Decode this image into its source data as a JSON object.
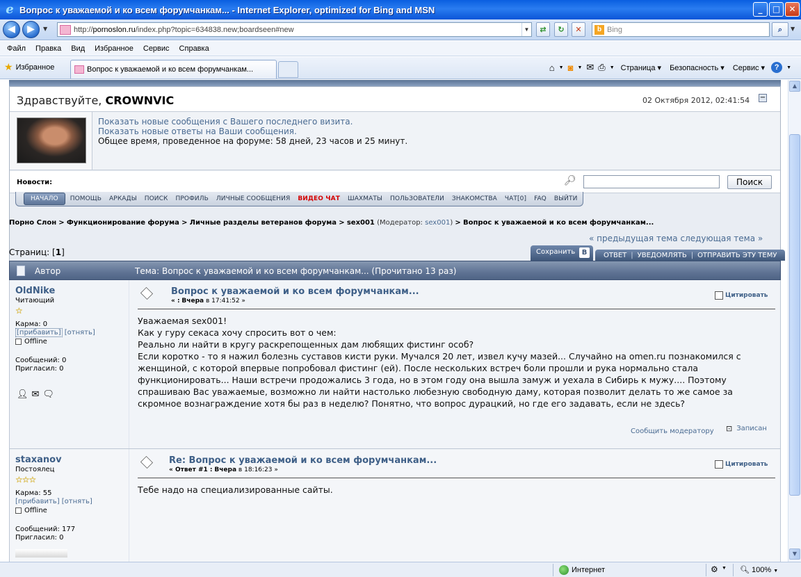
{
  "window": {
    "title": "Вопрос к уважаемой и ко всем форумчанкам... - Internet Explorer, optimized for Bing and MSN",
    "min": "_",
    "max": "□",
    "close": "✕"
  },
  "address": {
    "url_prefix": "http://",
    "url_host": "pornoslon.ru",
    "url_path": "/index.php?topic=634838.new;boardseen#new",
    "search_placeholder": "Bing"
  },
  "menu": [
    "Файл",
    "Правка",
    "Вид",
    "Избранное",
    "Сервис",
    "Справка"
  ],
  "favorites": {
    "label": "Избранное",
    "tab_title": "Вопрос к уважаемой и ко всем форумчанкам..."
  },
  "commandbar": {
    "page": "Страница",
    "safety": "Безопасность",
    "tools": "Сервис",
    "help": "?"
  },
  "status": {
    "zone": "Интернет",
    "zoom": "100%"
  },
  "welcome": {
    "greeting": "Здравствуйте, ",
    "username": "CROWNVIC",
    "datetime": "02 Октября 2012, 02:41:54",
    "link_new_posts": "Показать новые сообщения с Вашего последнего визита.",
    "link_new_replies": "Показать новые ответы на Ваши сообщения.",
    "total_time": "Общее время, проведенное на форуме: 58 дней, 23 часов и 25 минут.",
    "news_label": "Новости:",
    "search_button": "Поиск"
  },
  "nav": [
    "НАЧАЛО",
    "ПОМОЩЬ",
    "АРКАДЫ",
    "ПОИСК",
    "ПРОФИЛЬ",
    "ЛИЧНЫЕ СООБЩЕНИЯ",
    "ВИДЕО ЧАТ",
    "ШАХМАТЫ",
    "ПОЛЬЗОВАТЕЛИ",
    "ЗНАКОМСТВА",
    "ЧАТ[0]",
    "FAQ",
    "ВЫЙТИ"
  ],
  "breadcrumb": {
    "c1": "Порно Слон",
    "c2": "Функционирование форума",
    "c3": "Личные разделы ветеранов форума",
    "c4": "sex001",
    "mod_prefix": "(Модератор:",
    "mod_name": "sex001",
    "mod_suffix": ")",
    "c5": "Вопрос к уважаемой и ко всем форумчанкам...",
    "sep": ">"
  },
  "topic_nav": {
    "prev": "« предыдущая тема",
    "next": "следующая тема »",
    "pages_label": "Страниц: [",
    "pages_current": "1",
    "pages_end": "]",
    "save": "Сохранить",
    "save_icon": "B",
    "reply": "ОТВЕТ",
    "notify": "УВЕДОМЛЯТЬ",
    "send": "ОТПРАВИТЬ ЭТУ ТЕМУ"
  },
  "thead": {
    "author": "Автор",
    "topic": "Тема: Вопрос к уважаемой и ко всем форумчанкам...  (Прочитано 13 раз)"
  },
  "posts": [
    {
      "user": "OldNike",
      "rank": "Читающий",
      "stars": "☆",
      "karma": "Карма: 0",
      "plus": "[прибавить]",
      "minus": "[отнять]",
      "online": "Offline",
      "messages": "Сообщений: 0",
      "invited": "Пригласил: 0",
      "title": "Вопрос к уважаемой и ко всем форумчанкам...",
      "meta_prefix": "« :",
      "meta_day": "Вчера",
      "meta_at": "в 17:41:52 »",
      "quote": "Цитировать",
      "body": [
        "Уважаемая sex001!",
        "Как у гуру секаса хочу спросить вот о чем:",
        "Реально ли найти в кругу раскрепощенных дам любящих фистинг особ?",
        "Если коротко - то я нажил болезнь суставов кисти руки. Мучался 20 лет, извел кучу мазей... Случайно на omen.ru познакомился с женщиной, с которой впервые попробовал фистинг (ей). После нескольких встреч боли прошли и рука нормально стала функционировать... Наши встречи продожались 3 года, но в этом году она вышла замуж и уехала в Сибирь к мужу.... Поэтому спрашиваю Вас уважаемые, возможно ли найти настолько любезную свободную даму, которая позволит делать то же самое за скромное вознаграждение хотя бы раз в неделю? Понятно, что вопрос дурацкий, но где его задавать, если не здесь?"
      ],
      "report": "Сообщить модератору",
      "recorded": "Записан"
    },
    {
      "user": "staxanov",
      "rank": "Постоялец",
      "stars": "☆☆☆",
      "karma": "Карма: 55",
      "plus": "[прибавить]",
      "minus": "[отнять]",
      "online": "Offline",
      "messages": "Сообщений: 177",
      "invited": "Пригласил: 0",
      "title": "Re: Вопрос к уважаемой и ко всем форумчанкам...",
      "meta_prefix": "« Ответ #1 :",
      "meta_day": "Вчера",
      "meta_at": "в 18:16:23 »",
      "quote": "Цитировать",
      "body": [
        "Тебе надо на специализированные сайты."
      ]
    }
  ]
}
